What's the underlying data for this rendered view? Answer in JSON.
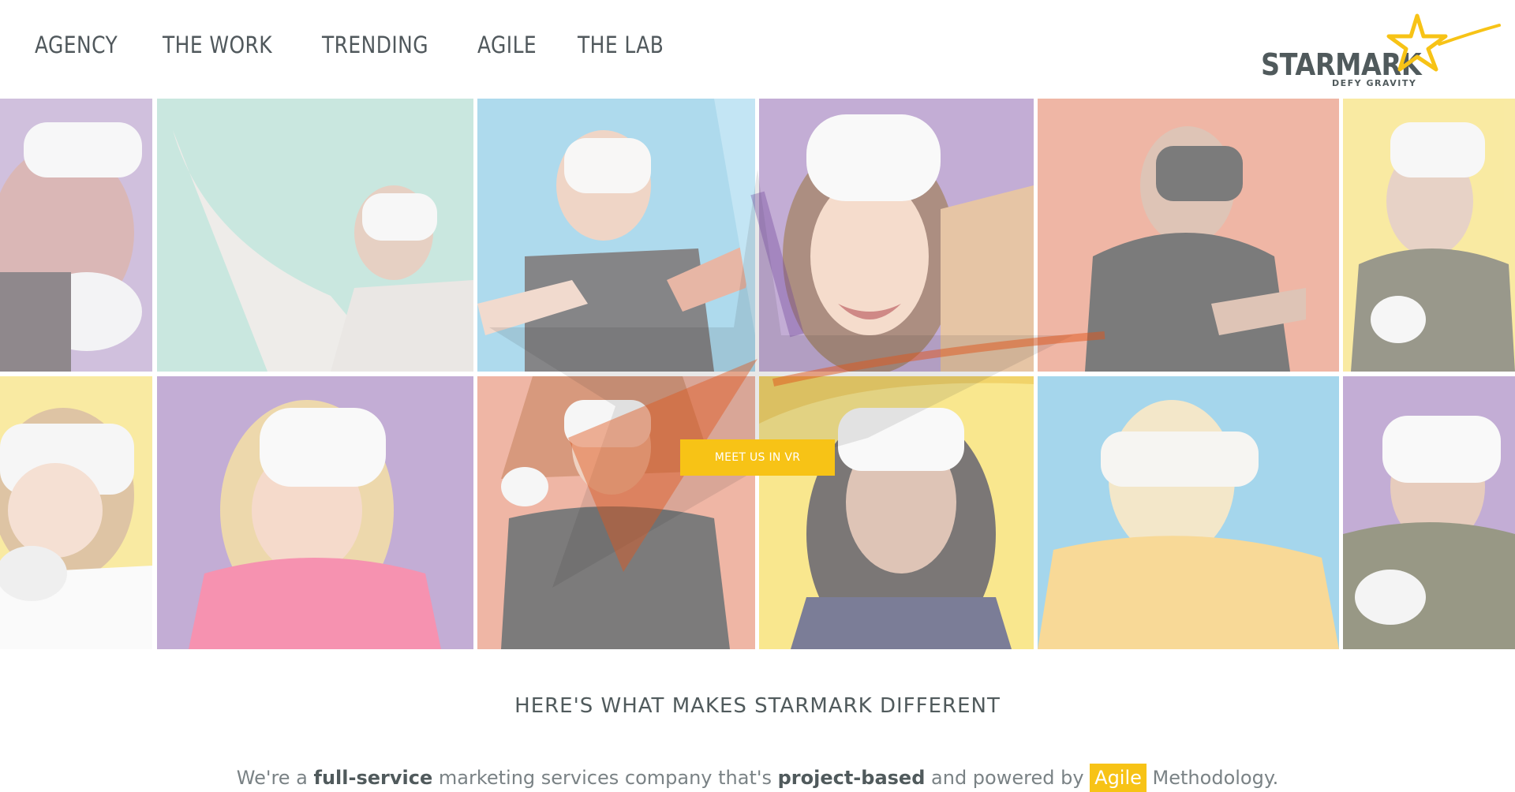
{
  "nav": {
    "items": [
      "AGENCY",
      "THE WORK",
      "TRENDING",
      "AGILE",
      "THE LAB"
    ]
  },
  "logo": {
    "wordmark": "STARMARK",
    "tagline": "DEFY GRAVITY",
    "star_color": "#f7c316"
  },
  "hero": {
    "cta_label": "MEET US IN VR"
  },
  "section": {
    "title": "HERE'S WHAT MAKES STARMARK DIFFERENT",
    "intro_parts": {
      "p1": "We're a ",
      "b1": "full-service",
      "p2": " marketing services company that's ",
      "b2": "project-based",
      "p3": " and powered by ",
      "highlight": "Agile",
      "p4": " Methodology."
    }
  },
  "colors": {
    "accent": "#f7c316",
    "text": "#505a5c",
    "purple": "#b49ac9",
    "mint": "#a9d9cc",
    "sky": "#7cc4e2",
    "peach": "#e5a58d",
    "yellow": "#f6dd6a"
  }
}
